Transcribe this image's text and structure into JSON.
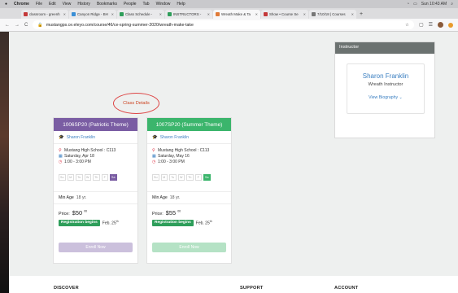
{
  "menubar": {
    "apple": "",
    "app": "Chrome",
    "items": [
      "File",
      "Edit",
      "View",
      "History",
      "Bookmarks",
      "People",
      "Tab",
      "Window",
      "Help"
    ],
    "status": "Sun 10:43 AM"
  },
  "tabs": [
    {
      "title": "classroom - greenh",
      "fav_color": "#c4393a"
    },
    {
      "title": "Canyon Ridge - BH",
      "fav_color": "#3b8fd6"
    },
    {
      "title": "Class Schedule -",
      "fav_color": "#2f9e5a"
    },
    {
      "title": "INSTRUCTORS -",
      "fav_color": "#2f9e5a"
    },
    {
      "title": "Wreath Make & Ta",
      "fav_color": "#e07b39",
      "active": true
    },
    {
      "title": "Show • Course Se",
      "fav_color": "#c4393a"
    },
    {
      "title": "7/10/18 | Courses",
      "fav_color": "#777"
    }
  ],
  "newtab_label": "+",
  "toolbar": {
    "back": "←",
    "forward": "→",
    "reload": "C",
    "url": "mustangps.ce.eleyo.com/course/46/ce-spring-summer-2020/wreath-make-take",
    "star": "☆",
    "lock": "🔒"
  },
  "page": {
    "class_details_label": "Class Details",
    "instructor_panel": {
      "header": "Instructor",
      "name": "Sharon Franklin",
      "role": "Wreath Instructor",
      "bio_link": "View Biography ⌄"
    },
    "cards": [
      {
        "title": "1006SP20 (Patriotic Theme)",
        "head_color": "#7a5da3",
        "instructor": "Sharon Franklin",
        "location": "Mustang High School : C113",
        "date": "Saturday, Apr 18",
        "time": "1:00 - 3:00 PM",
        "days": [
          "Su",
          "M",
          "Tu",
          "W",
          "Th",
          "F",
          "Sa"
        ],
        "active_day": 6,
        "active_color": "#7a5da3",
        "min_age_label": "Min Age",
        "min_age": "18 yr.",
        "price_label": "Price:",
        "price": "$50",
        "price_cents": "00",
        "reg_label": "Registration begins",
        "reg_date": "Feb. 25",
        "reg_sup": "th",
        "enroll_label": "Enroll Now",
        "enroll_color": "#cbc0dc"
      },
      {
        "title": "1007SP20 (Summer Theme)",
        "head_color": "#3bb56c",
        "instructor": "Sharon Franklin",
        "location": "Mustang High School : C113",
        "date": "Saturday, May 16",
        "time": "1:00 - 3:00 PM",
        "days": [
          "Su",
          "M",
          "Tu",
          "W",
          "Th",
          "F",
          "Sa"
        ],
        "active_day": 6,
        "active_color": "#3bb56c",
        "min_age_label": "Min Age",
        "min_age": "18 yr.",
        "price_label": "Price:",
        "price": "$55",
        "price_cents": "00",
        "reg_label": "Registration begins",
        "reg_date": "Feb. 25",
        "reg_sup": "th",
        "enroll_label": "Enroll Now",
        "enroll_color": "#b5e2c5"
      }
    ],
    "footer": {
      "discover": "DISCOVER",
      "support": "SUPPORT",
      "account": "ACCOUNT"
    }
  }
}
